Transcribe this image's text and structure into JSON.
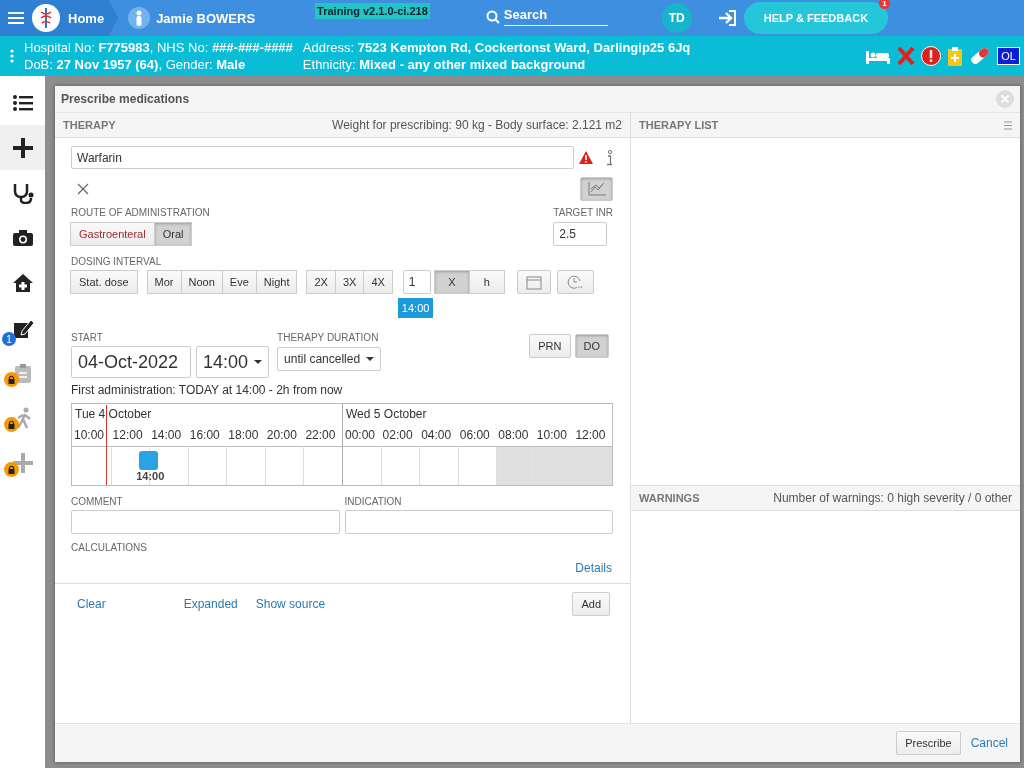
{
  "topbar": {
    "home": "Home",
    "patient_name": "Jamie BOWERS",
    "version": "Training v2.1.0-ci.218",
    "search_placeholder": "Search",
    "user_initials": "TD",
    "help_button": "HELP & FEEDBACK",
    "help_badge": "1"
  },
  "patient_bar": {
    "lines": [
      "Hospital No: **F775983**, NHS No: **###-###-####**",
      "Address: **7523 Kempton Rd, Cockertonst Ward, Darlingip25 6Jq**",
      "DoB: **27 Nov 1957 (64)**, Gender: **Male**",
      "Ethnicity: **Mixed - any other mixed background**"
    ],
    "alert_badge": "OL"
  },
  "sidebar": {
    "items": [
      {
        "selected": false,
        "locked": false
      },
      {
        "selected": true,
        "locked": false
      },
      {
        "selected": false,
        "locked": false
      },
      {
        "selected": false,
        "locked": false
      },
      {
        "selected": false,
        "locked": false
      },
      {
        "selected": false,
        "locked": false,
        "badge": "1"
      },
      {
        "selected": false,
        "locked": true
      },
      {
        "selected": false,
        "locked": true
      },
      {
        "selected": false,
        "locked": true
      }
    ]
  },
  "dialog": {
    "title": "Prescribe medications",
    "therapy": {
      "header": "THERAPY",
      "weight": "Weight for prescribing: 90 kg - Body surface: 2.121 m2",
      "medication": "Warfarin",
      "chart_toggle": {
        "selected": true
      },
      "route_label": "ROUTE OF ADMINISTRATION",
      "routes": [
        {
          "label": "Gastroenteral",
          "selected": false,
          "flagged": true
        },
        {
          "label": "Oral",
          "selected": true,
          "flagged": false
        }
      ],
      "target_label": "TARGET INR",
      "target_value": "2.5",
      "dosing_label": "DOSING INTERVAL",
      "dosing_groups": [
        {
          "buttons": [
            {
              "label": "Stat. dose",
              "selected": false
            }
          ]
        },
        {
          "buttons": [
            {
              "label": "Mor",
              "selected": false
            },
            {
              "label": "Noon",
              "selected": false
            },
            {
              "label": "Eve",
              "selected": false
            },
            {
              "label": "Night",
              "selected": false
            }
          ]
        },
        {
          "buttons": [
            {
              "label": "2X",
              "selected": false
            },
            {
              "label": "3X",
              "selected": false
            },
            {
              "label": "4X",
              "selected": false
            }
          ]
        }
      ],
      "frequency_value": "1",
      "frequency_units": [
        {
          "label": "X",
          "selected": true
        },
        {
          "label": "h",
          "selected": false
        }
      ],
      "time_tooltip": "14:00",
      "start_label": "START",
      "start_date": "04-Oct-2022",
      "start_time": "14:00",
      "duration_label": "THERAPY DURATION",
      "duration": "until cancelled",
      "flags": [
        {
          "label": "PRN",
          "selected": false
        },
        {
          "label": "DO",
          "selected": true
        }
      ],
      "first_administration": "First administration: TODAY at 14:00 - 2h from now",
      "timeline": {
        "days": [
          "Tue 4 October",
          "Wed 5 October"
        ],
        "hours": [
          {
            "label": "10:00",
            "now": true,
            "shaded": false
          },
          {
            "label": "12:00",
            "now": false,
            "shaded": false
          },
          {
            "label": "14:00",
            "now": false,
            "shaded": false,
            "dose": "14:00"
          },
          {
            "label": "16:00",
            "now": false,
            "shaded": false
          },
          {
            "label": "18:00",
            "now": false,
            "shaded": false
          },
          {
            "label": "20:00",
            "now": false,
            "shaded": false
          },
          {
            "label": "22:00",
            "now": false,
            "shaded": false
          },
          {
            "label": "00:00",
            "now": false,
            "shaded": false
          },
          {
            "label": "02:00",
            "now": false,
            "shaded": false
          },
          {
            "label": "04:00",
            "now": false,
            "shaded": false
          },
          {
            "label": "06:00",
            "now": false,
            "shaded": false
          },
          {
            "label": "08:00",
            "now": false,
            "shaded": true
          },
          {
            "label": "10:00",
            "now": false,
            "shaded": true
          },
          {
            "label": "12:00",
            "now": false,
            "shaded": true
          }
        ]
      },
      "comment_label": "COMMENT",
      "indication_label": "INDICATION",
      "calculations_label": "CALCULATIONS",
      "details_link": "Details",
      "footer_links": [
        "Clear",
        "Expanded",
        "Show source"
      ],
      "add_button": "Add"
    },
    "therapy_list": {
      "header": "THERAPY LIST"
    },
    "warnings": {
      "header": "WARNINGS",
      "summary": "Number of warnings: 0 high severity / 0 other"
    },
    "prescribe_button": "Prescribe",
    "cancel_link": "Cancel"
  }
}
